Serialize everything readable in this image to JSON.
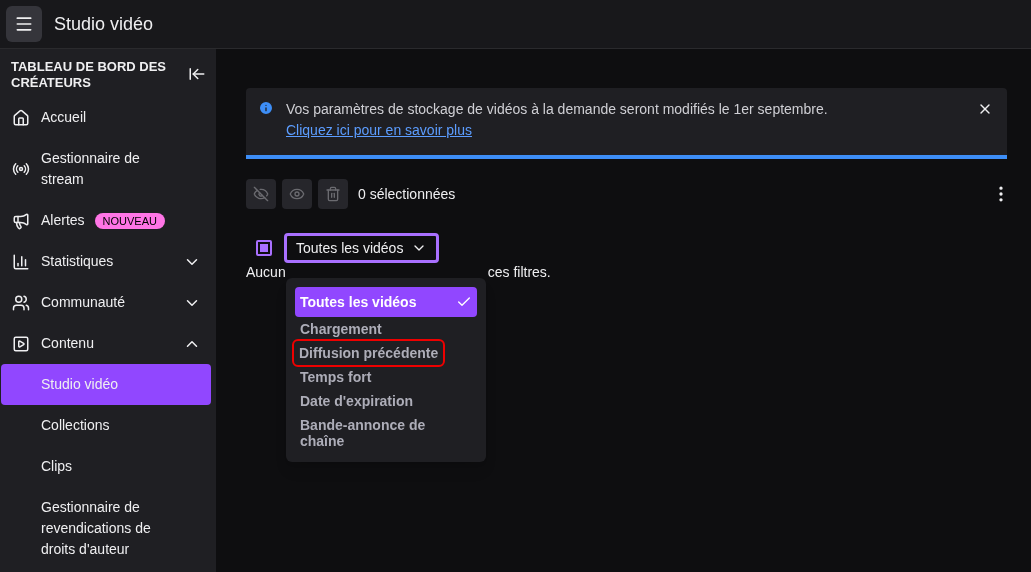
{
  "header": {
    "title": "Studio vidéo"
  },
  "sidebar": {
    "heading": "TABLEAU DE BORD DES CRÉATEURS",
    "items": [
      {
        "label": "Accueil",
        "selected": false
      },
      {
        "label": "Gestionnaire de stream",
        "selected": false
      },
      {
        "label": "Alertes",
        "badge": "NOUVEAU",
        "selected": false
      },
      {
        "label": "Statistiques",
        "expanded": false,
        "selected": false
      },
      {
        "label": "Communauté",
        "expanded": false,
        "selected": false
      },
      {
        "label": "Contenu",
        "expanded": true,
        "selected": false,
        "children": [
          {
            "label": "Studio vidéo",
            "selected": true
          },
          {
            "label": "Collections",
            "selected": false
          },
          {
            "label": "Clips",
            "selected": false
          },
          {
            "label": "Gestionnaire de revendications de droits d'auteur",
            "selected": false
          }
        ]
      }
    ]
  },
  "banner": {
    "text": "Vos paramètres de stockage de vidéos à la demande seront modifiés le 1er septembre.",
    "link": "Cliquez ici pour en savoir plus"
  },
  "toolbar": {
    "selection_count": "0 sélectionnées"
  },
  "select_all": {
    "indeterminate": true
  },
  "filter": {
    "value": "Toutes les vidéos",
    "expanded": true,
    "options": [
      {
        "label": "Toutes les vidéos",
        "selected": true,
        "highlighted": false
      },
      {
        "label": "Chargement",
        "selected": false,
        "highlighted": false
      },
      {
        "label": "Diffusion précédente",
        "selected": false,
        "highlighted": true
      },
      {
        "label": "Temps fort",
        "selected": false,
        "highlighted": false
      },
      {
        "label": "Date d'expiration",
        "selected": false,
        "highlighted": false
      },
      {
        "label": "Bande-annonce de chaîne",
        "selected": false,
        "highlighted": false
      }
    ]
  },
  "empty_message_parts": [
    "Aucun",
    "ces filtres."
  ]
}
